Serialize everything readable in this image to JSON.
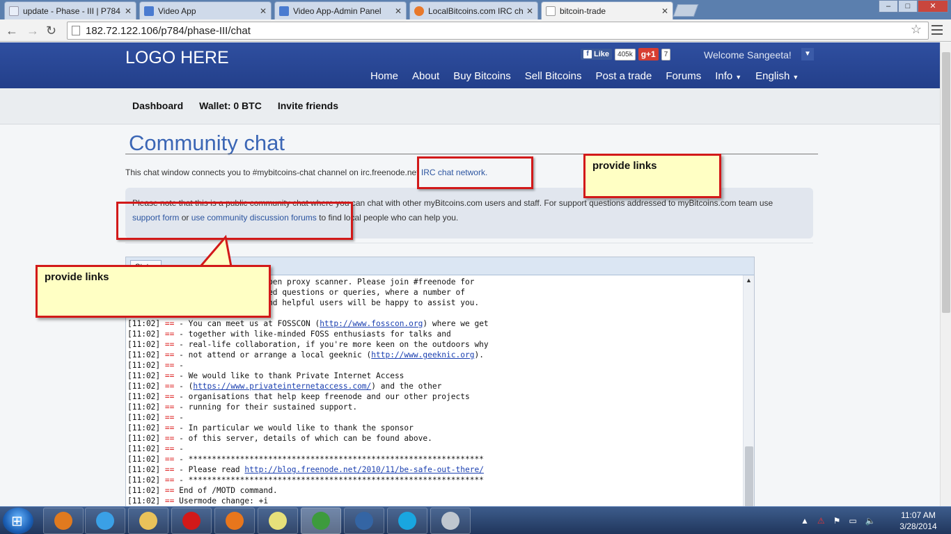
{
  "browser": {
    "tabs": [
      {
        "label": "update - Phase - III | P784",
        "icon_color": "#e8eef8",
        "icon": "pipl-icon"
      },
      {
        "label": "Video App",
        "icon_color": "#4a7bd0",
        "icon": "video-app-icon"
      },
      {
        "label": "Video App-Admin Panel",
        "icon_color": "#4a7bd0",
        "icon": "video-app-icon"
      },
      {
        "label": "LocalBitcoins.com IRC cha",
        "icon_color": "#e8792b",
        "icon": "localbitcoins-icon"
      },
      {
        "label": "bitcoin-trade",
        "icon_color": "#ffffff",
        "icon": "page-icon"
      }
    ],
    "url": "182.72.122.106/p784/phase-III/chat",
    "window_buttons": {
      "minimize": "–",
      "maximize": "□",
      "close": "✕"
    }
  },
  "site": {
    "logo": "LOGO HERE",
    "social": {
      "fb_like": "Like",
      "fb_count": "405k",
      "gplus": "g+1",
      "gplus_count": "7"
    },
    "welcome": "Welcome Sangeeta!",
    "nav": [
      "Home",
      "About",
      "Buy Bitcoins",
      "Sell Bitcoins",
      "Post a trade",
      "Forums",
      "Info",
      "English"
    ],
    "subnav": [
      "Dashboard",
      "Wallet: 0 BTC",
      "Invite friends"
    ]
  },
  "page": {
    "title": "Community chat",
    "intro_text": "This chat window connects you to #mybitcoins-chat channel on irc.freenode.net ",
    "intro_link": "IRC chat network.",
    "note_text": "Please note that this is a public community chat where you can chat with other myBitcoins.com users and staff. For support questions addressed to myBitcoins.com team use",
    "note_link1": "support form",
    "note_mid": " or ",
    "note_link2": "use community discussion forums",
    "note_end": " to find local people who can help you."
  },
  "chat": {
    "tab_label": "Status",
    "lines": [
      {
        "ts": "",
        "eq": "",
        "text": "                             open proxy scanner. Please join #freenode for",
        "link": ""
      },
      {
        "ts": "",
        "eq": "",
        "text": "                             ted questions or queries, where a number of",
        "link": ""
      },
      {
        "ts": "",
        "eq": "",
        "text": "                             and helpful users will be happy to assist you.",
        "link": ""
      },
      {
        "ts": "[11:02]",
        "eq": "==",
        "text": " -",
        "link": ""
      },
      {
        "ts": "[11:02]",
        "eq": "==",
        "text": " - You can meet us at FOSSCON (",
        "link": "http://www.fosscon.org",
        "after": ") where we get"
      },
      {
        "ts": "[11:02]",
        "eq": "==",
        "text": " - together with like-minded FOSS enthusiasts for talks and",
        "link": ""
      },
      {
        "ts": "[11:02]",
        "eq": "==",
        "text": " - real-life collaboration, if you're more keen on the outdoors why",
        "link": ""
      },
      {
        "ts": "[11:02]",
        "eq": "==",
        "text": " - not attend or arrange a local geeknic (",
        "link": "http://www.geeknic.org",
        "after": ")."
      },
      {
        "ts": "[11:02]",
        "eq": "==",
        "text": " -",
        "link": ""
      },
      {
        "ts": "[11:02]",
        "eq": "==",
        "text": " - We would like to thank Private Internet Access",
        "link": ""
      },
      {
        "ts": "[11:02]",
        "eq": "==",
        "text": " - (",
        "link": "https://www.privateinternetaccess.com/",
        "after": ") and the other"
      },
      {
        "ts": "[11:02]",
        "eq": "==",
        "text": " - organisations that help keep freenode and our other projects",
        "link": ""
      },
      {
        "ts": "[11:02]",
        "eq": "==",
        "text": " - running for their sustained support.",
        "link": ""
      },
      {
        "ts": "[11:02]",
        "eq": "==",
        "text": " -",
        "link": ""
      },
      {
        "ts": "[11:02]",
        "eq": "==",
        "text": " - In particular we would like to thank the sponsor",
        "link": ""
      },
      {
        "ts": "[11:02]",
        "eq": "==",
        "text": " - of this server, details of which can be found above.",
        "link": ""
      },
      {
        "ts": "[11:02]",
        "eq": "==",
        "text": " -",
        "link": ""
      },
      {
        "ts": "[11:02]",
        "eq": "==",
        "text": " - ***************************************************************",
        "link": ""
      },
      {
        "ts": "[11:02]",
        "eq": "==",
        "text": " - Please read ",
        "link": "http://blog.freenode.net/2010/11/be-safe-out-there/",
        "after": ""
      },
      {
        "ts": "[11:02]",
        "eq": "==",
        "text": " - ***************************************************************",
        "link": ""
      },
      {
        "ts": "[11:02]",
        "eq": "==",
        "text": " End of /MOTD command.",
        "link": ""
      },
      {
        "ts": "[11:02]",
        "eq": "==",
        "text": " Usermode change: +i",
        "link": ""
      }
    ]
  },
  "annotations": {
    "callout_top": "provide links",
    "callout_left": "provide links"
  },
  "taskbar": {
    "apps": [
      {
        "name": "media-player-icon",
        "color": "#e07a1f"
      },
      {
        "name": "internet-explorer-icon",
        "color": "#3aa0e6"
      },
      {
        "name": "file-explorer-icon",
        "color": "#e9c25a"
      },
      {
        "name": "opera-icon",
        "color": "#d21919"
      },
      {
        "name": "firefox-icon",
        "color": "#e8761c"
      },
      {
        "name": "sticky-notes-icon",
        "color": "#e6e07a"
      },
      {
        "name": "chrome-icon",
        "color": "#3d9b3d"
      },
      {
        "name": "thunderbird-icon",
        "color": "#3465a4"
      },
      {
        "name": "skype-icon",
        "color": "#19a6e0"
      },
      {
        "name": "archive-icon",
        "color": "#bfc6cf"
      }
    ],
    "time": "11:07 AM",
    "date": "3/28/2014"
  }
}
